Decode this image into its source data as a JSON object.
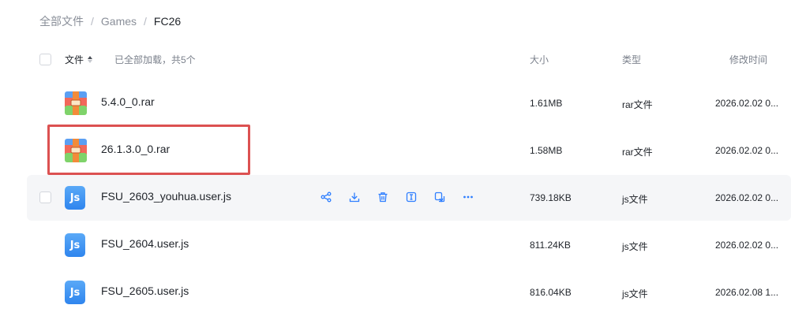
{
  "breadcrumb": [
    "全部文件",
    "Games",
    "FC26"
  ],
  "header": {
    "name": "文件",
    "loaded_status": "已全部加载，共5个",
    "size": "大小",
    "type": "类型",
    "modified": "修改时间"
  },
  "files": [
    {
      "name": "5.4.0_0.rar",
      "size": "1.61MB",
      "type": "rar文件",
      "time": "2026.02.02 0...",
      "icon": "rar-archive-icon"
    },
    {
      "name": "26.1.3.0_0.rar",
      "size": "1.58MB",
      "type": "rar文件",
      "time": "2026.02.02 0...",
      "icon": "rar-archive-icon"
    },
    {
      "name": "FSU_2603_youhua.user.js",
      "size": "739.18KB",
      "type": "js文件",
      "time": "2026.02.02 0...",
      "icon": "js-file-icon"
    },
    {
      "name": "FSU_2604.user.js",
      "size": "811.24KB",
      "type": "js文件",
      "time": "2026.02.02 0...",
      "icon": "js-file-icon"
    },
    {
      "name": "FSU_2605.user.js",
      "size": "816.04KB",
      "type": "js文件",
      "time": "2026.02.08 1...",
      "icon": "js-file-icon"
    }
  ],
  "js_badge": "Js",
  "row_actions": [
    "share-icon",
    "download-icon",
    "delete-icon",
    "rename-icon",
    "copy-icon",
    "more-icon"
  ],
  "colors": {
    "accent": "#2f7fff",
    "highlight_border": "#dc5151",
    "hover_row": "#f5f6f8"
  }
}
